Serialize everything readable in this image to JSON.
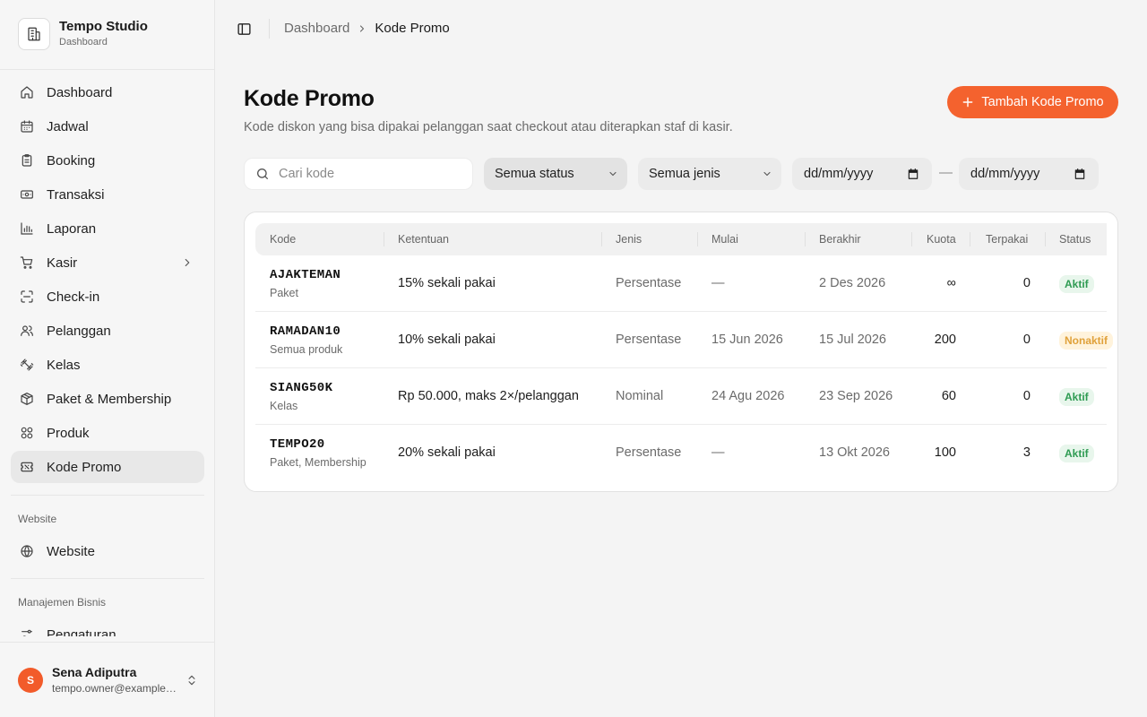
{
  "brand": {
    "name": "Tempo Studio",
    "subtitle": "Dashboard"
  },
  "sidebar": {
    "items": [
      {
        "label": "Dashboard",
        "icon": "home-icon"
      },
      {
        "label": "Jadwal",
        "icon": "calendar-icon"
      },
      {
        "label": "Booking",
        "icon": "clipboard-icon"
      },
      {
        "label": "Transaksi",
        "icon": "banknote-icon"
      },
      {
        "label": "Laporan",
        "icon": "bar-chart-icon"
      },
      {
        "label": "Kasir",
        "icon": "cart-icon"
      },
      {
        "label": "Check-in",
        "icon": "scan-icon"
      },
      {
        "label": "Pelanggan",
        "icon": "users-icon"
      },
      {
        "label": "Kelas",
        "icon": "dumbbell-icon"
      },
      {
        "label": "Paket & Membership",
        "icon": "package-icon"
      },
      {
        "label": "Produk",
        "icon": "shapes-icon"
      },
      {
        "label": "Kode Promo",
        "icon": "ticket-icon"
      }
    ],
    "website_section": "Website",
    "website_item": "Website",
    "business_section": "Manajemen Bisnis",
    "business_item": "Pengaturan"
  },
  "user": {
    "initial": "S",
    "name": "Sena Adiputra",
    "email": "tempo.owner@example.com"
  },
  "breadcrumb": {
    "parent": "Dashboard",
    "current": "Kode Promo"
  },
  "page": {
    "title": "Kode Promo",
    "subtitle": "Kode diskon yang bisa dipakai pelanggan saat checkout atau diterapkan staf di kasir.",
    "add_button": "Tambah Kode Promo"
  },
  "filters": {
    "search_placeholder": "Cari kode",
    "status": "Semua status",
    "type": "Semua jenis",
    "date_from": "dd/mm/yyyy",
    "date_separator": "—",
    "date_to": "dd/mm/yyyy"
  },
  "table": {
    "headers": {
      "kode": "Kode",
      "ketentuan": "Ketentuan",
      "jenis": "Jenis",
      "mulai": "Mulai",
      "berakhir": "Berakhir",
      "kuota": "Kuota",
      "terpakai": "Terpakai",
      "status": "Status"
    },
    "rows": [
      {
        "code": "AJAKTEMAN",
        "scope": "Paket",
        "terms": "15% sekali pakai",
        "type": "Persentase",
        "start": "—",
        "end": "2 Des 2026",
        "quota": "∞",
        "used": "0",
        "status": "Aktif"
      },
      {
        "code": "RAMADAN10",
        "scope": "Semua produk",
        "terms": "10% sekali pakai",
        "type": "Persentase",
        "start": "15 Jun 2026",
        "end": "15 Jul 2026",
        "quota": "200",
        "used": "0",
        "status": "Nonaktif"
      },
      {
        "code": "SIANG50K",
        "scope": "Kelas",
        "terms": "Rp 50.000, maks 2×/pelanggan",
        "type": "Nominal",
        "start": "24 Agu 2026",
        "end": "23 Sep 2026",
        "quota": "60",
        "used": "0",
        "status": "Aktif"
      },
      {
        "code": "TEMPO20",
        "scope": "Paket, Membership",
        "terms": "20% sekali pakai",
        "type": "Persentase",
        "start": "—",
        "end": "13 Okt 2026",
        "quota": "100",
        "used": "3",
        "status": "Aktif"
      }
    ]
  },
  "colors": {
    "accent": "#f4622e",
    "active_badge_bg": "#e8f6ec",
    "active_badge_text": "#2e9b52",
    "inactive_badge_bg": "#fff3dc",
    "inactive_badge_text": "#e0a13a"
  }
}
